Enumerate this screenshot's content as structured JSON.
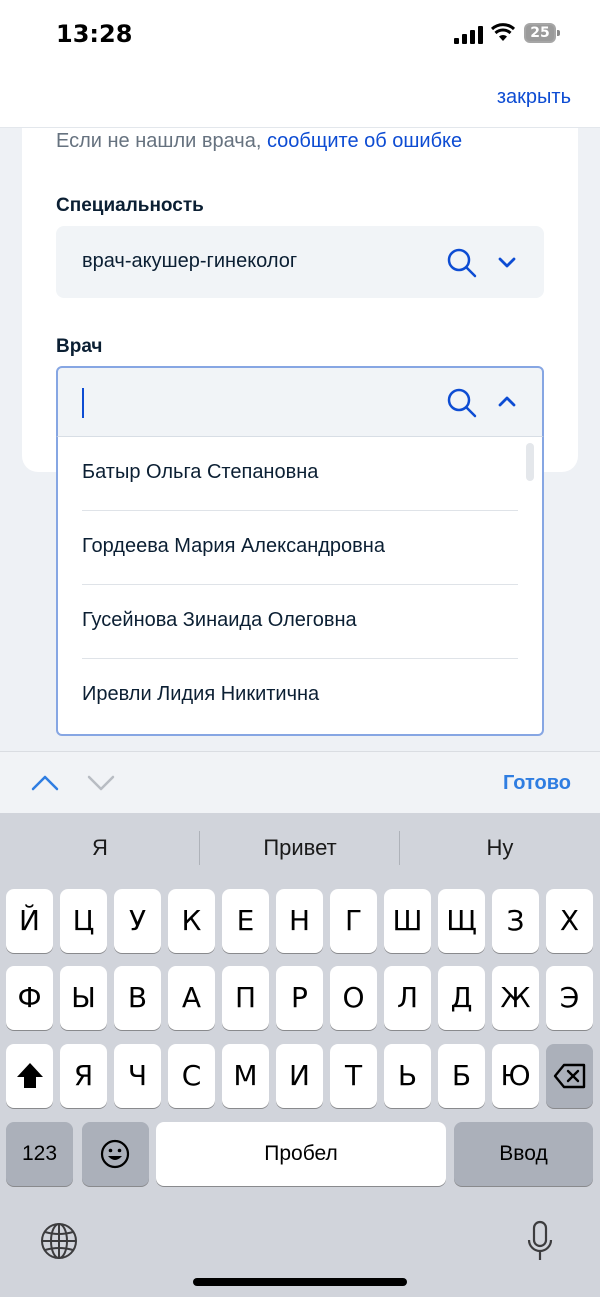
{
  "status": {
    "time": "13:28",
    "battery": "25"
  },
  "header": {
    "close": "закрыть"
  },
  "form": {
    "hint_text": "Если не нашли врача,",
    "hint_link": "сообщите об ошибке",
    "specialty": {
      "label": "Специальность",
      "value": "врач-акушер-гинеколог",
      "search_icon": "search-icon",
      "toggle_icon": "chevron-down-icon"
    },
    "doctor": {
      "label": "Врач",
      "value": "",
      "search_icon": "search-icon",
      "toggle_icon": "chevron-up-icon"
    }
  },
  "dropdown": {
    "options": [
      "Батыр Ольга Степановна",
      "Гордеева Мария Александровна",
      "Гусейнова Зинаида Олеговна",
      "Иревли Лидия Никитична"
    ]
  },
  "accessory": {
    "done": "Готово"
  },
  "keyboard": {
    "suggestions": [
      "Я",
      "Привет",
      "Ну"
    ],
    "row1": [
      "Й",
      "Ц",
      "У",
      "К",
      "Е",
      "Н",
      "Г",
      "Ш",
      "Щ",
      "З",
      "Х"
    ],
    "row2": [
      "Ф",
      "Ы",
      "В",
      "А",
      "П",
      "Р",
      "О",
      "Л",
      "Д",
      "Ж",
      "Э"
    ],
    "row3": [
      "Я",
      "Ч",
      "С",
      "М",
      "И",
      "Т",
      "Ь",
      "Б",
      "Ю"
    ],
    "numbers": "123",
    "space": "Пробел",
    "enter": "Ввод"
  },
  "colors": {
    "accent": "#0d4cd3",
    "border_active": "#86a6e3",
    "field_bg": "#f1f4f7"
  }
}
